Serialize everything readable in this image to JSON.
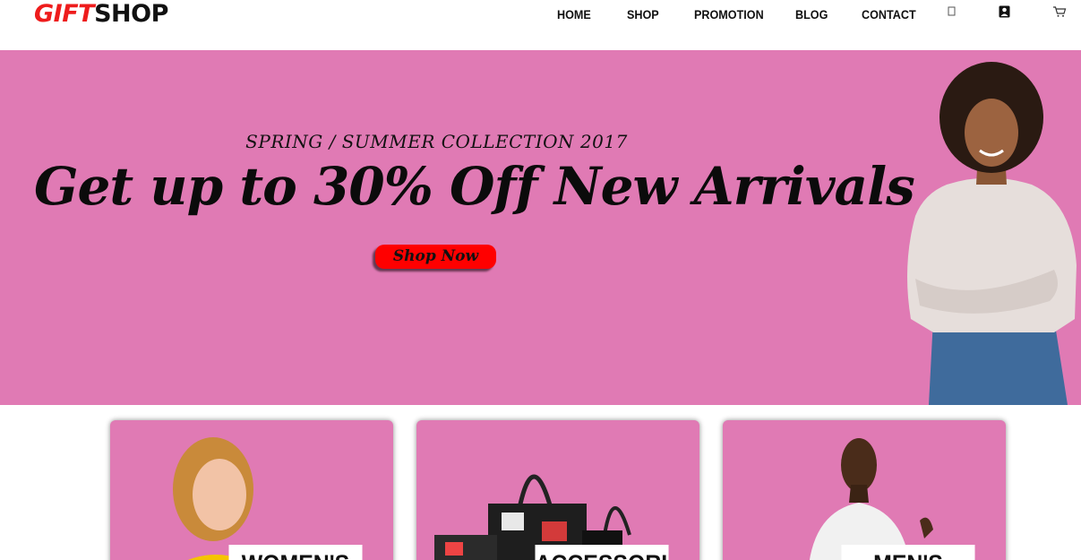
{
  "brand": {
    "part1": "GIFT",
    "part2": "SHOP"
  },
  "nav": {
    "items": [
      {
        "label": "HOME"
      },
      {
        "label": "SHOP"
      },
      {
        "label": "PROMOTION"
      },
      {
        "label": "BLOG"
      },
      {
        "label": "CONTACT"
      }
    ],
    "icons": [
      "search-icon",
      "user-icon",
      "cart-icon"
    ]
  },
  "hero": {
    "subtitle": "SPRING / SUMMER COLLECTION 2017",
    "title": "Get up to 30% Off New Arrivals",
    "button": "Shop Now",
    "background": "#e07ab4",
    "button_color": "#ff0000"
  },
  "categories": [
    {
      "label": "WOMEN'S"
    },
    {
      "label": "ACCESSORIES"
    },
    {
      "label": "MEN'S"
    }
  ],
  "colors": {
    "brand_red": "#ee1c1c",
    "pink": "#e07ab4"
  }
}
